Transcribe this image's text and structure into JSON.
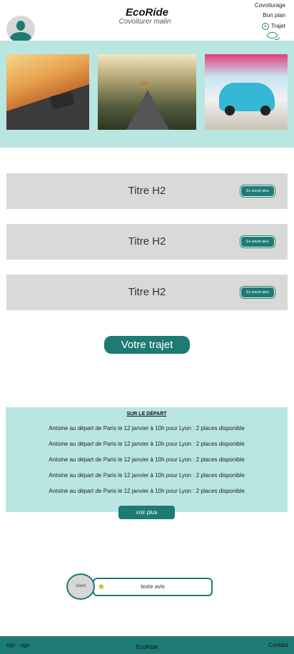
{
  "header": {
    "brand": "EcoRide",
    "tagline": "Covoiturer malin",
    "nav": {
      "covoiturage": "Covoiturage",
      "bon_plan": "Bon plan",
      "trajet": "Trajet"
    },
    "icons": [
      "user-avatar-icon",
      "plus-circle-icon",
      "chat-icon"
    ]
  },
  "cards": [
    {
      "title": "Titre H2",
      "button": "En savoir plus"
    },
    {
      "title": "Titre H2",
      "button": "En savoir plus"
    },
    {
      "title": "Titre H2",
      "button": "En savoir plus"
    }
  ],
  "cta": "Votre trajet",
  "departures": {
    "title": "SUR LE DÉPART",
    "items": [
      "Antoine au départ de Paris le 12 janvier à 10h pour Lyon : 2 places disponible",
      "Antoine au départ de Paris le 12 janvier à 10h pour Lyon : 2 places disponible",
      "Antoine au départ de Paris le 12 janvier à 10h pour Lyon : 2 places disponible",
      "Antoine au départ de Paris le 12 janvier à 10h pour Lyon : 2 places disponible",
      "Antoine au départ de Paris le 12 janvier à 10h pour Lyon : 2 places disponible"
    ],
    "more": "voir plus"
  },
  "review": {
    "client": "client",
    "text": "texte avis"
  },
  "footer": {
    "left": "cgv - cgu",
    "center": "EcoRide",
    "right": "Contact"
  },
  "colors": {
    "accent": "#1e7b73",
    "band": "#b9e6e1",
    "card": "#d9d9d9"
  }
}
